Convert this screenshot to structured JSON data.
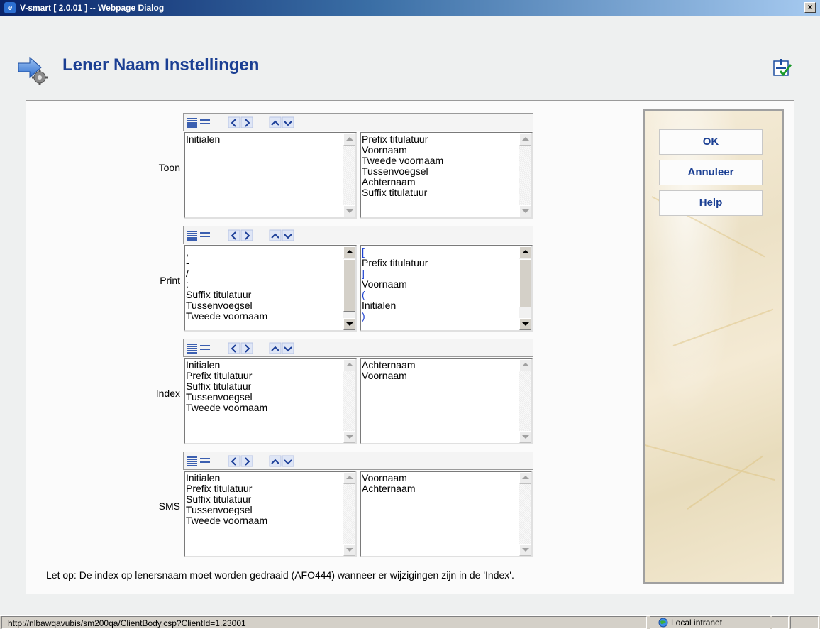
{
  "window": {
    "title": "V-smart [ 2.0.01 ] -- Webpage Dialog",
    "close_label": "×"
  },
  "page": {
    "title": "Lener Naam Instellingen"
  },
  "sections": [
    {
      "label": "Toon",
      "left_items": [
        "Initialen"
      ],
      "right_items": [
        "Prefix titulatuur",
        "Voornaam",
        "Tweede voornaam",
        "Tussenvoegsel",
        "Achternaam",
        "Suffix titulatuur"
      ]
    },
    {
      "label": "Print",
      "left_items": [
        ",",
        "-",
        "/",
        ":",
        "Suffix titulatuur",
        "Tussenvoegsel",
        "Tweede voornaam"
      ],
      "right_items": [
        "[",
        "Prefix titulatuur",
        "]",
        "Voornaam",
        "(",
        "Initialen",
        ")"
      ]
    },
    {
      "label": "Index",
      "left_items": [
        "Initialen",
        "Prefix titulatuur",
        "Suffix titulatuur",
        "Tussenvoegsel",
        "Tweede voornaam"
      ],
      "right_items": [
        "Achternaam",
        "Voornaam"
      ]
    },
    {
      "label": "SMS",
      "left_items": [
        "Initialen",
        "Prefix titulatuur",
        "Suffix titulatuur",
        "Tussenvoegsel",
        "Tweede voornaam"
      ],
      "right_items": [
        "Voornaam",
        "Achternaam"
      ]
    }
  ],
  "note": "Let op: De index op lenersnaam moet worden gedraaid (AFO444) wanneer er wijzigingen zijn in de 'Index'.",
  "buttons": {
    "ok": "OK",
    "cancel": "Annuleer",
    "help": "Help"
  },
  "statusbar": {
    "url": "http://nlbawqavubis/sm200qa/ClientBody.csp?ClientId=1.23001",
    "zone": "Local intranet"
  }
}
